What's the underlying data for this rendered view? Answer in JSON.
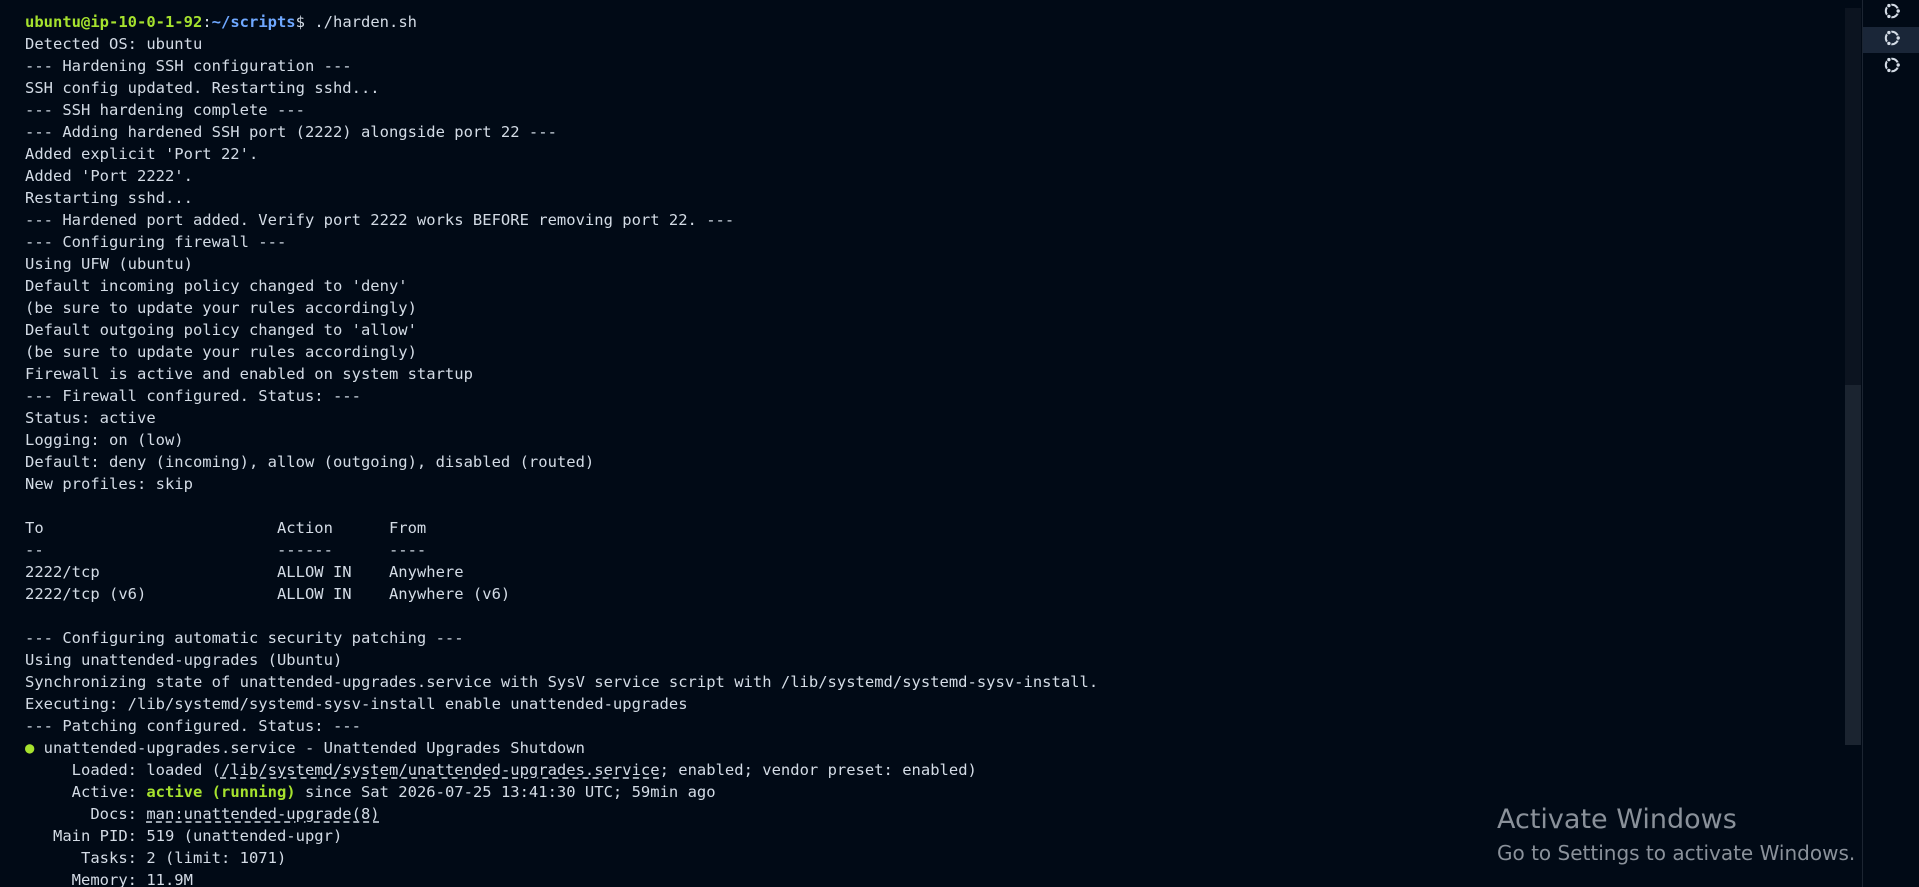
{
  "prompt": {
    "user_host": "ubuntu@ip-10-0-1-92",
    "sep": ":",
    "path": "~/scripts",
    "dollar": "$ ",
    "command": "./harden.sh"
  },
  "output_lines": [
    "Detected OS: ubuntu",
    "--- Hardening SSH configuration ---",
    "SSH config updated. Restarting sshd...",
    "--- SSH hardening complete ---",
    "--- Adding hardened SSH port (2222) alongside port 22 ---",
    "Added explicit 'Port 22'.",
    "Added 'Port 2222'.",
    "Restarting sshd...",
    "--- Hardened port added. Verify port 2222 works BEFORE removing port 22. ---",
    "--- Configuring firewall ---",
    "Using UFW (ubuntu)",
    "Default incoming policy changed to 'deny'",
    "(be sure to update your rules accordingly)",
    "Default outgoing policy changed to 'allow'",
    "(be sure to update your rules accordingly)",
    "Firewall is active and enabled on system startup",
    "--- Firewall configured. Status: ---",
    "Status: active",
    "Logging: on (low)",
    "Default: deny (incoming), allow (outgoing), disabled (routed)",
    "New profiles: skip",
    "",
    "To                         Action      From",
    "--                         ------      ----",
    "2222/tcp                   ALLOW IN    Anywhere",
    "2222/tcp (v6)              ALLOW IN    Anywhere (v6)",
    "",
    "--- Configuring automatic security patching ---",
    "Using unattended-upgrades (Ubuntu)",
    "Synchronizing state of unattended-upgrades.service with SysV service script with /lib/systemd/systemd-sysv-install.",
    "Executing: /lib/systemd/systemd-sysv-install enable unattended-upgrades",
    "--- Patching configured. Status: ---"
  ],
  "service_status": {
    "bullet": "●",
    "header": " unattended-upgrades.service - Unattended Upgrades Shutdown",
    "loaded_label": "     Loaded: ",
    "loaded_pre": "loaded (",
    "loaded_path": "/lib/systemd/system/unattended-upgrades.service",
    "loaded_post": "; enabled; vendor preset: enabled)",
    "active_label": "     Active: ",
    "active_state": "active (running)",
    "active_rest": " since Sat 2026-07-25 13:41:30 UTC; 59min ago",
    "docs_label": "       Docs: ",
    "docs_value": "man:unattended-upgrade(8)",
    "mainpid": "   Main PID: 519 (unattended-upgr)",
    "tasks": "      Tasks: 2 (limit: 1071)",
    "memory": "     Memory: 11.9M"
  },
  "tabs": [
    {
      "icon": "ubuntu-icon",
      "active": false
    },
    {
      "icon": "ubuntu-icon",
      "active": true
    },
    {
      "icon": "ubuntu-icon",
      "active": false
    }
  ],
  "watermark": {
    "title": "Activate Windows",
    "subtitle": "Go to Settings to activate Windows."
  },
  "colors": {
    "background": "#010a16",
    "text": "#d4dce6",
    "prompt_user": "#a6e22e",
    "prompt_path": "#6fa8ff",
    "status_green": "#a6e22e"
  }
}
